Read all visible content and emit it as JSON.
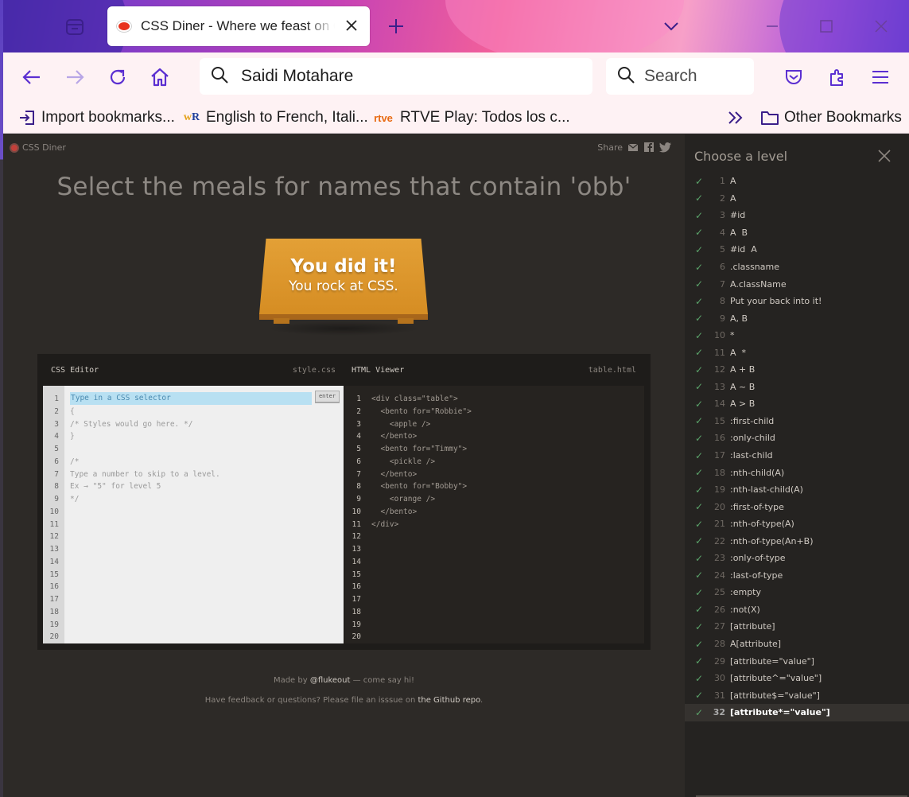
{
  "browser": {
    "tab_title": "CSS Diner - Where we feast on CSS",
    "url": "Saidi Motahare",
    "search_placeholder": "Search",
    "bookmarks": [
      {
        "label": "Import bookmarks...",
        "icon": "import-icon"
      },
      {
        "label": "English to French, Itali...",
        "icon": "wordreference-icon"
      },
      {
        "label": "RTVE Play: Todos los c...",
        "icon": "rtve-icon"
      }
    ],
    "other_bookmarks": "Other Bookmarks",
    "colors": {
      "toolbar": "#fef2f4",
      "accent": "#5b2fd1"
    }
  },
  "page": {
    "logo": "CSS Diner",
    "share": "Share",
    "order": "Select the meals for names that contain 'obb'",
    "win_line1": "You did it!",
    "win_line2": "You rock at CSS.",
    "css_editor": {
      "title": "CSS Editor",
      "file": "style.css",
      "input_placeholder": "Type in a CSS selector",
      "enter_label": "enter",
      "line_numbers": "1\n2\n3\n4\n5\n6\n7\n8\n9\n10\n11\n12\n13\n14\n15\n16\n17\n18\n19\n20",
      "code": "\n{\n/* Styles would go here. */\n}\n\n/*\nType a number to skip to a level.\nEx → \"5\" for level 5\n*/"
    },
    "html_viewer": {
      "title": "HTML Viewer",
      "file": "table.html",
      "line_numbers": "1\n2\n3\n4\n5\n6\n7\n8\n9\n10\n11\n12\n13\n14\n15\n16\n17\n18\n19\n20",
      "code": "<div class=\"table\">\n  <bento for=\"Robbie\">\n    <apple />\n  </bento>\n  <bento for=\"Timmy\">\n    <pickle />\n  </bento>\n  <bento for=\"Bobby\">\n    <orange />\n  </bento>\n</div>"
    },
    "footer": {
      "made_by_prefix": "Made by ",
      "made_by_link": "@flukeout",
      "made_by_suffix": " — come say hi!",
      "feedback_prefix": "Have feedback or questions? Please file an isssue on ",
      "feedback_link": "the Github repo",
      "feedback_suffix": "."
    }
  },
  "levels": {
    "title": "Choose a level",
    "current": 32,
    "items": [
      {
        "num": "1",
        "label": "A"
      },
      {
        "num": "2",
        "label": "A"
      },
      {
        "num": "3",
        "label": "#id"
      },
      {
        "num": "4",
        "label": "A  B"
      },
      {
        "num": "5",
        "label": "#id  A"
      },
      {
        "num": "6",
        "label": ".classname"
      },
      {
        "num": "7",
        "label": "A.className"
      },
      {
        "num": "8",
        "label": "Put your back into it!"
      },
      {
        "num": "9",
        "label": "A, B"
      },
      {
        "num": "10",
        "label": "*"
      },
      {
        "num": "11",
        "label": "A  *"
      },
      {
        "num": "12",
        "label": "A + B"
      },
      {
        "num": "13",
        "label": "A ~ B"
      },
      {
        "num": "14",
        "label": "A > B"
      },
      {
        "num": "15",
        "label": ":first-child"
      },
      {
        "num": "16",
        "label": ":only-child"
      },
      {
        "num": "17",
        "label": ":last-child"
      },
      {
        "num": "18",
        "label": ":nth-child(A)"
      },
      {
        "num": "19",
        "label": ":nth-last-child(A)"
      },
      {
        "num": "20",
        "label": ":first-of-type"
      },
      {
        "num": "21",
        "label": ":nth-of-type(A)"
      },
      {
        "num": "22",
        "label": ":nth-of-type(An+B)"
      },
      {
        "num": "23",
        "label": ":only-of-type"
      },
      {
        "num": "24",
        "label": ":last-of-type"
      },
      {
        "num": "25",
        "label": ":empty"
      },
      {
        "num": "26",
        "label": ":not(X)"
      },
      {
        "num": "27",
        "label": "[attribute]"
      },
      {
        "num": "28",
        "label": "A[attribute]"
      },
      {
        "num": "29",
        "label": "[attribute=\"value\"]"
      },
      {
        "num": "30",
        "label": "[attribute^=\"value\"]"
      },
      {
        "num": "31",
        "label": "[attribute$=\"value\"]"
      },
      {
        "num": "32",
        "label": "[attribute*=\"value\"]"
      }
    ]
  }
}
